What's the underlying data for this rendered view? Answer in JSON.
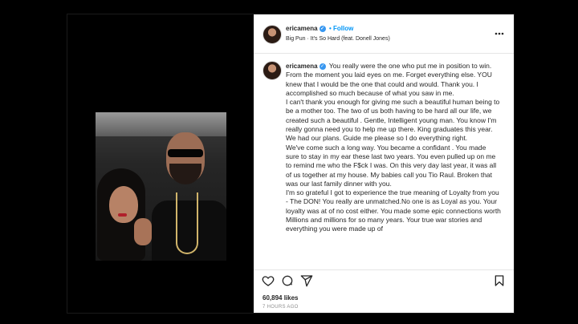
{
  "post": {
    "username": "ericamena",
    "follow_label": "Follow",
    "music": {
      "artist": "Big Pun",
      "separator": "·",
      "song": "It's So Hard (feat. Donell Jones)"
    },
    "more_icon": "more-horizontal-icon"
  },
  "caption": {
    "username": "ericamena",
    "paragraphs": [
      "You really were the one who put me in position to win.",
      "From the moment you laid eyes on me. Forget everything else. YOU knew that I would be the one that could and would. Thank you. I accomplished so much because of what you saw in me.",
      "I can't thank you enough for giving me such a beautiful human being to be a mother too. The two of us both having to be hard all our life, we created such a beautiful . Gentle, Intelligent young man. You know I'm really gonna need you to help me up there. King graduates this year. We had our plans. Guide me please so I do everything right.",
      "We've come such a long way. You became a confidant . You made sure to stay in my ear these last two years. You even pulled up on me to remind me who the F$ck I was. On this very day last year, it was all of us together at my house. My babies call you Tio Raul. Broken that was our last family dinner with you.",
      "I'm so grateful I got to experience the true meaning of Loyalty from you - The DON! You really are unmatched.No one is as Loyal as you. Your loyalty was at of no cost either. You made some epic connections worth Millions and millions for so many years. Your true war stories and everything you were made up of"
    ]
  },
  "actions": {
    "like_icon": "heart-icon",
    "comment_icon": "comment-icon",
    "share_icon": "send-icon",
    "save_icon": "bookmark-icon"
  },
  "stats": {
    "likes": "60,894 likes",
    "time_ago": "7 HOURS AGO"
  },
  "colors": {
    "accent": "#0095f6",
    "verified": "#3897f0",
    "text": "#262626",
    "muted": "#8e8e8e"
  }
}
